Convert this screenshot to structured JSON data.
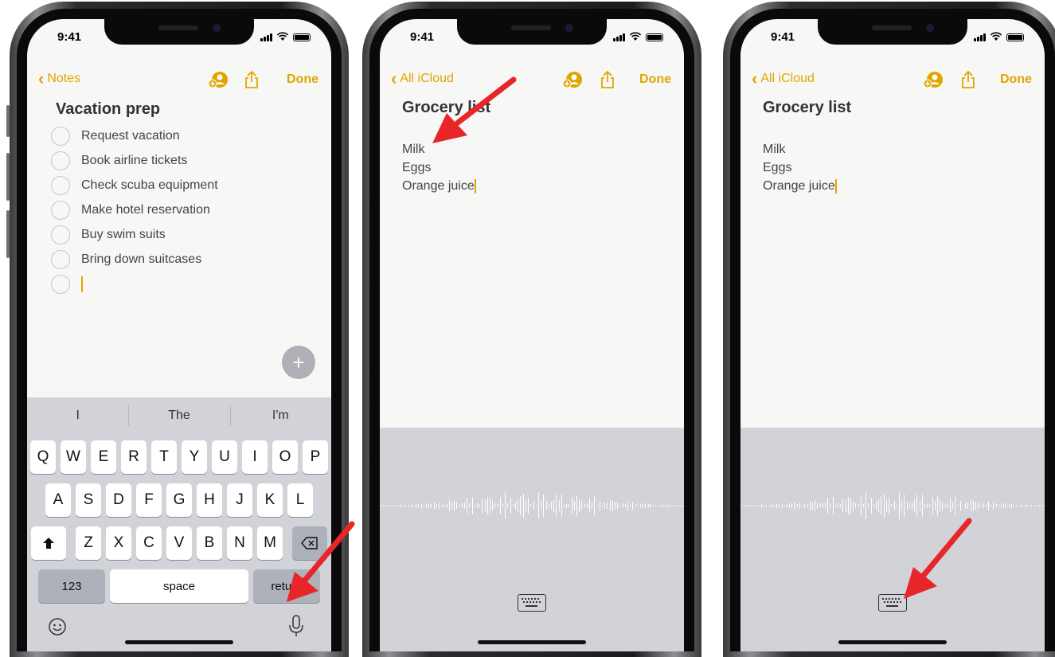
{
  "phone1": {
    "status_time": "9:41",
    "back_label": "Notes",
    "done_label": "Done",
    "note_title": "Vacation prep",
    "checklist": [
      "Request vacation",
      "Book airline tickets",
      "Check scuba equipment",
      "Make hotel reservation",
      "Buy swim suits",
      "Bring down suitcases"
    ],
    "suggestions": [
      "I",
      "The",
      "I'm"
    ],
    "keys_row1": [
      "Q",
      "W",
      "E",
      "R",
      "T",
      "Y",
      "U",
      "I",
      "O",
      "P"
    ],
    "keys_row2": [
      "A",
      "S",
      "D",
      "F",
      "G",
      "H",
      "J",
      "K",
      "L"
    ],
    "keys_row3": [
      "Z",
      "X",
      "C",
      "V",
      "B",
      "N",
      "M"
    ],
    "key_123": "123",
    "key_space": "space",
    "key_return": "return",
    "icons": [
      "chevron-left-icon",
      "add-person-icon",
      "share-icon",
      "plus-icon",
      "shift-icon",
      "delete-icon",
      "emoji-icon",
      "microphone-icon"
    ]
  },
  "phone2": {
    "status_time": "9:41",
    "back_label": "All iCloud",
    "done_label": "Done",
    "note_title": "Grocery list",
    "lines": [
      "Milk",
      "Eggs",
      "Orange juice"
    ],
    "icons": [
      "chevron-left-icon",
      "add-person-icon",
      "share-icon",
      "keyboard-icon"
    ]
  },
  "phone3": {
    "status_time": "9:41",
    "back_label": "All iCloud",
    "done_label": "Done",
    "note_title": "Grocery list",
    "lines": [
      "Milk",
      "Eggs",
      "Orange juice"
    ],
    "icons": [
      "chevron-left-icon",
      "add-person-icon",
      "share-icon",
      "keyboard-icon"
    ]
  },
  "colors": {
    "accent": "#e1a500",
    "arrow": "#e8262a",
    "keyboard_bg": "#d1d3d9"
  }
}
